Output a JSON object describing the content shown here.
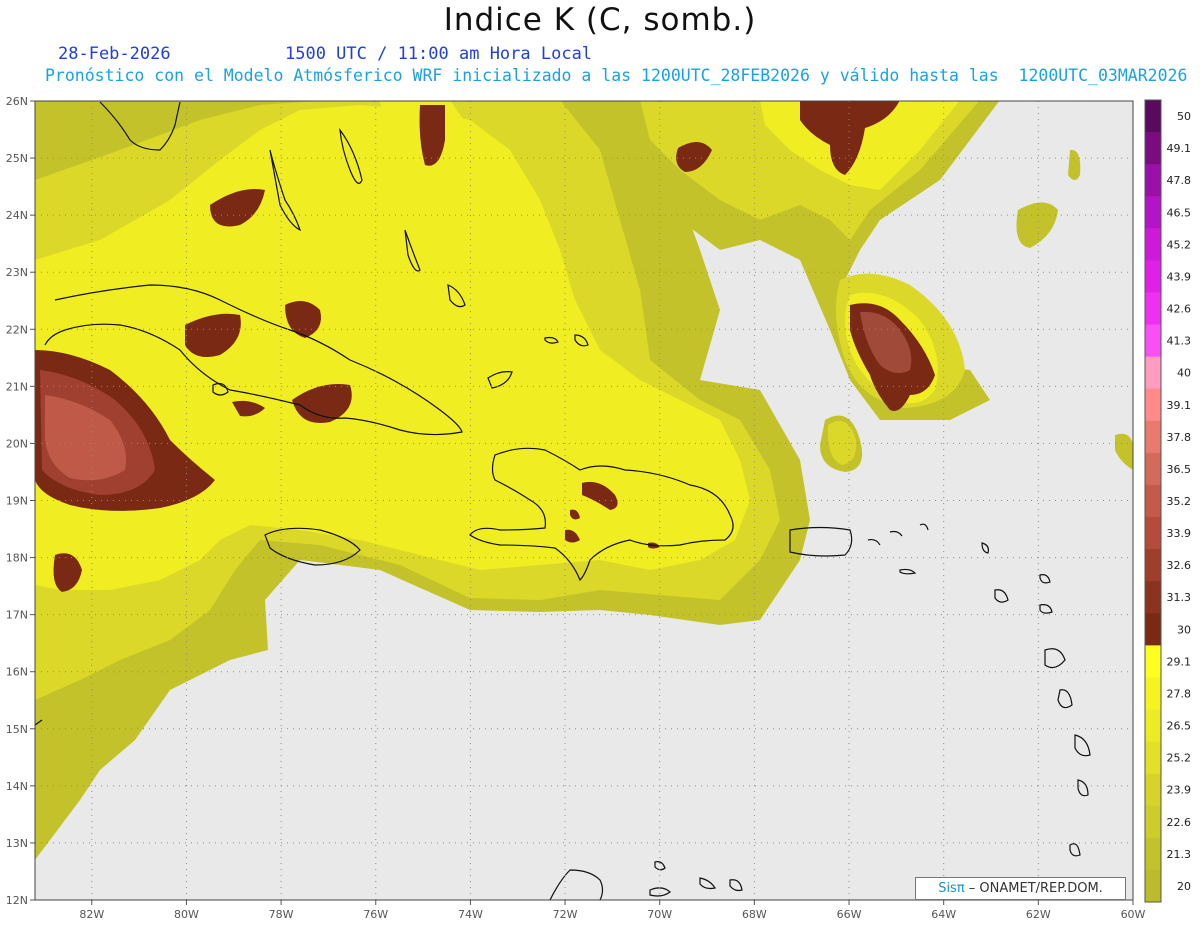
{
  "header": {
    "title": "Indice K (C, somb.)",
    "date": "28-Feb-2026",
    "time_line": "1500 UTC / 11:00 am Hora Local",
    "description": "Pronóstico con el Modelo Atmósferico WRF inicializado a las 1200UTC_28FEB2026 y válido hasta las  1200UTC_03MAR2026"
  },
  "map": {
    "lat_labels": [
      "26N",
      "25N",
      "24N",
      "23N",
      "22N",
      "21N",
      "20N",
      "19N",
      "18N",
      "17N",
      "16N",
      "15N",
      "14N",
      "13N",
      "12N"
    ],
    "lon_labels": [
      "82W",
      "80W",
      "78W",
      "76W",
      "74W",
      "72W",
      "70W",
      "68W",
      "66W",
      "64W",
      "62W",
      "60W"
    ],
    "lat_range": [
      12,
      26
    ],
    "lon_range": [
      -83.2,
      -60
    ],
    "grid": true,
    "background_color": "#e9e9e9"
  },
  "colorbar": {
    "labels": [
      "50",
      "49.1",
      "47.8",
      "46.5",
      "45.2",
      "43.9",
      "42.6",
      "41.3",
      "40",
      "39.1",
      "37.8",
      "36.5",
      "35.2",
      "33.9",
      "32.6",
      "31.3",
      "30",
      "29.1",
      "27.8",
      "26.5",
      "25.2",
      "23.9",
      "22.6",
      "21.3",
      "20"
    ],
    "colors": [
      "#5a0a5e",
      "#7a0c80",
      "#9a10a8",
      "#b414c8",
      "#cc1ad8",
      "#e020e6",
      "#ee30f0",
      "#f850f5",
      "#ff9cc0",
      "#ff8a8a",
      "#e87a70",
      "#d46a5a",
      "#c45a48",
      "#b44c3a",
      "#a03e2c",
      "#8c3220",
      "#7a2a14",
      "#ffff20",
      "#f6f420",
      "#ecec24",
      "#e2e028",
      "#d6d42a",
      "#cccc2a",
      "#c2c22a",
      "#bcbc2a"
    ]
  },
  "credit": {
    "brand": "Sisπ",
    "text": " – ONAMET/REP.DOM."
  }
}
